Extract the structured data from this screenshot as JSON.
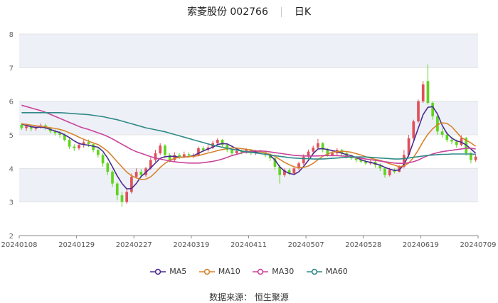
{
  "title": {
    "stock": "索菱股份 002766",
    "period": "日K"
  },
  "source": "数据来源： 恒生聚源",
  "colors": {
    "up": "#e0505a",
    "down": "#5fd51e",
    "MA5": "#4b2c91",
    "MA10": "#d7822c",
    "MA30": "#c9439a",
    "MA60": "#2f8a88",
    "band": "#eef0f7"
  },
  "chart_data": {
    "type": "candlestick",
    "xlabels": [
      "20240108",
      "20240129",
      "20240227",
      "20240319",
      "20240411",
      "20240507",
      "20240528",
      "20240619",
      "20240709"
    ],
    "ylim": [
      2,
      8
    ],
    "yticks": [
      2,
      3,
      4,
      5,
      6,
      7,
      8
    ],
    "candles": [
      [
        5.3,
        5.2,
        5.35,
        5.15
      ],
      [
        5.2,
        5.25,
        5.32,
        5.12
      ],
      [
        5.25,
        5.18,
        5.3,
        5.1
      ],
      [
        5.18,
        5.22,
        5.28,
        5.12
      ],
      [
        5.22,
        5.28,
        5.34,
        5.18
      ],
      [
        5.28,
        5.2,
        5.33,
        5.14
      ],
      [
        5.2,
        5.1,
        5.24,
        5.04
      ],
      [
        5.1,
        5.05,
        5.16,
        4.98
      ],
      [
        5.05,
        5.0,
        5.12,
        4.92
      ],
      [
        5.0,
        4.85,
        5.05,
        4.8
      ],
      [
        4.85,
        4.65,
        4.9,
        4.58
      ],
      [
        4.65,
        4.6,
        4.72,
        4.52
      ],
      [
        4.6,
        4.7,
        4.78,
        4.55
      ],
      [
        4.7,
        4.78,
        4.85,
        4.62
      ],
      [
        4.78,
        4.72,
        4.86,
        4.64
      ],
      [
        4.72,
        4.55,
        4.76,
        4.48
      ],
      [
        4.55,
        4.4,
        4.6,
        4.32
      ],
      [
        4.4,
        4.15,
        4.45,
        4.05
      ],
      [
        4.15,
        3.9,
        4.2,
        3.8
      ],
      [
        3.9,
        3.55,
        3.95,
        3.45
      ],
      [
        3.55,
        3.2,
        3.6,
        3.05
      ],
      [
        3.2,
        3.0,
        3.3,
        2.85
      ],
      [
        3.0,
        3.3,
        3.4,
        2.95
      ],
      [
        3.3,
        3.75,
        3.85,
        3.25
      ],
      [
        3.75,
        3.9,
        4.0,
        3.7
      ],
      [
        3.9,
        3.8,
        3.98,
        3.72
      ],
      [
        3.8,
        4.0,
        4.05,
        3.75
      ],
      [
        4.0,
        4.25,
        4.32,
        3.96
      ],
      [
        4.25,
        4.45,
        4.55,
        4.2
      ],
      [
        4.45,
        4.68,
        4.75,
        4.4
      ],
      [
        4.68,
        4.4,
        4.72,
        4.3
      ],
      [
        4.4,
        4.25,
        4.45,
        4.18
      ],
      [
        4.25,
        4.4,
        4.48,
        4.2
      ],
      [
        4.4,
        4.35,
        4.45,
        4.28
      ],
      [
        4.35,
        4.42,
        4.5,
        4.3
      ],
      [
        4.42,
        4.38,
        4.48,
        4.32
      ],
      [
        4.38,
        4.4,
        4.45,
        4.3
      ],
      [
        4.4,
        4.6,
        4.65,
        4.36
      ],
      [
        4.6,
        4.55,
        4.66,
        4.48
      ],
      [
        4.55,
        4.62,
        4.7,
        4.5
      ],
      [
        4.62,
        4.75,
        4.82,
        4.58
      ],
      [
        4.75,
        4.85,
        4.9,
        4.7
      ],
      [
        4.85,
        4.7,
        4.88,
        4.62
      ],
      [
        4.7,
        4.55,
        4.74,
        4.48
      ],
      [
        4.55,
        4.45,
        4.6,
        4.38
      ],
      [
        4.45,
        4.52,
        4.58,
        4.4
      ],
      [
        4.52,
        4.48,
        4.56,
        4.42
      ],
      [
        4.48,
        4.55,
        4.6,
        4.44
      ],
      [
        4.55,
        4.45,
        4.58,
        4.4
      ],
      [
        4.45,
        4.5,
        4.55,
        4.4
      ],
      [
        4.5,
        4.48,
        4.55,
        4.42
      ],
      [
        4.48,
        4.4,
        4.52,
        4.34
      ],
      [
        4.4,
        4.3,
        4.45,
        4.22
      ],
      [
        4.3,
        4.05,
        4.34,
        3.95
      ],
      [
        4.05,
        3.8,
        4.1,
        3.55
      ],
      [
        3.8,
        3.95,
        4.0,
        3.75
      ],
      [
        3.95,
        3.85,
        4.0,
        3.8
      ],
      [
        3.85,
        4.0,
        4.05,
        3.82
      ],
      [
        4.0,
        4.15,
        4.2,
        3.95
      ],
      [
        4.15,
        4.35,
        4.42,
        4.1
      ],
      [
        4.35,
        4.5,
        4.56,
        4.3
      ],
      [
        4.5,
        4.62,
        4.68,
        4.45
      ],
      [
        4.62,
        4.75,
        4.88,
        4.58
      ],
      [
        4.75,
        4.55,
        4.78,
        4.48
      ],
      [
        4.55,
        4.4,
        4.6,
        4.35
      ],
      [
        4.4,
        4.45,
        4.52,
        4.38
      ],
      [
        4.45,
        4.55,
        4.6,
        4.4
      ],
      [
        4.55,
        4.45,
        4.58,
        4.38
      ],
      [
        4.45,
        4.35,
        4.5,
        4.3
      ],
      [
        4.35,
        4.3,
        4.4,
        4.25
      ],
      [
        4.3,
        4.25,
        4.35,
        4.18
      ],
      [
        4.25,
        4.2,
        4.3,
        4.15
      ],
      [
        4.2,
        4.15,
        4.25,
        4.1
      ],
      [
        4.15,
        4.2,
        4.25,
        4.1
      ],
      [
        4.2,
        4.1,
        4.24,
        4.02
      ],
      [
        4.1,
        4.0,
        4.15,
        3.92
      ],
      [
        4.0,
        3.8,
        4.05,
        3.72
      ],
      [
        3.8,
        3.95,
        4.02,
        3.76
      ],
      [
        3.95,
        3.9,
        4.0,
        3.85
      ],
      [
        3.9,
        4.05,
        4.1,
        3.88
      ],
      [
        4.05,
        4.4,
        4.55,
        4.0
      ],
      [
        4.4,
        4.9,
        5.0,
        4.35
      ],
      [
        4.9,
        5.4,
        5.45,
        4.85
      ],
      [
        5.4,
        6.0,
        6.05,
        5.35
      ],
      [
        6.0,
        6.5,
        6.6,
        5.95
      ],
      [
        6.6,
        5.95,
        7.1,
        5.9
      ],
      [
        5.95,
        5.55,
        6.0,
        5.45
      ],
      [
        5.55,
        5.1,
        5.6,
        5.0
      ],
      [
        5.1,
        5.0,
        5.2,
        4.92
      ],
      [
        5.0,
        4.85,
        5.08,
        4.78
      ],
      [
        4.85,
        4.8,
        4.95,
        4.72
      ],
      [
        4.8,
        4.7,
        4.86,
        4.62
      ],
      [
        4.7,
        4.9,
        4.98,
        4.66
      ],
      [
        4.9,
        4.45,
        4.94,
        4.38
      ],
      [
        4.45,
        4.25,
        4.5,
        4.15
      ],
      [
        4.25,
        4.35,
        4.42,
        4.2
      ]
    ],
    "series": [
      {
        "name": "MA5",
        "values": [
          5.32,
          5.28,
          5.24,
          5.22,
          5.23,
          5.21,
          5.16,
          5.11,
          5.07,
          5.0,
          4.92,
          4.82,
          4.74,
          4.71,
          4.69,
          4.66,
          4.63,
          4.51,
          4.31,
          4.05,
          3.78,
          3.55,
          3.39,
          3.4,
          3.55,
          3.76,
          3.88,
          4.02,
          4.16,
          4.3,
          4.35,
          4.36,
          4.36,
          4.33,
          4.34,
          4.35,
          4.38,
          4.45,
          4.52,
          4.58,
          4.63,
          4.71,
          4.74,
          4.73,
          4.66,
          4.58,
          4.52,
          4.48,
          4.48,
          4.49,
          4.49,
          4.46,
          4.39,
          4.25,
          4.05,
          3.92,
          3.85,
          3.82,
          3.9,
          4.06,
          4.24,
          4.44,
          4.58,
          4.59,
          4.56,
          4.53,
          4.5,
          4.45,
          4.41,
          4.38,
          4.32,
          4.26,
          4.21,
          4.18,
          4.14,
          4.1,
          4.03,
          3.98,
          3.94,
          3.95,
          4.12,
          4.4,
          4.8,
          5.2,
          5.6,
          5.82,
          5.84,
          5.62,
          5.28,
          5.04,
          4.9,
          4.82,
          4.78,
          4.7,
          4.58,
          4.45
        ]
      },
      {
        "name": "MA10",
        "values": [
          5.33,
          5.31,
          5.29,
          5.27,
          5.25,
          5.24,
          5.21,
          5.19,
          5.16,
          5.12,
          5.06,
          5.0,
          4.93,
          4.87,
          4.81,
          4.76,
          4.71,
          4.62,
          4.51,
          4.36,
          4.2,
          4.04,
          3.89,
          3.78,
          3.72,
          3.67,
          3.68,
          3.75,
          3.88,
          4.03,
          4.15,
          4.24,
          4.3,
          4.33,
          4.34,
          4.35,
          4.36,
          4.38,
          4.42,
          4.46,
          4.49,
          4.53,
          4.56,
          4.59,
          4.61,
          4.61,
          4.59,
          4.57,
          4.55,
          4.52,
          4.49,
          4.46,
          4.42,
          4.36,
          4.27,
          4.18,
          4.11,
          4.05,
          4.02,
          4.03,
          4.07,
          4.15,
          4.26,
          4.36,
          4.43,
          4.48,
          4.5,
          4.51,
          4.5,
          4.48,
          4.44,
          4.4,
          4.35,
          4.31,
          4.27,
          4.24,
          4.19,
          4.14,
          4.1,
          4.05,
          4.08,
          4.16,
          4.33,
          4.55,
          4.8,
          5.02,
          5.18,
          5.3,
          5.36,
          5.34,
          5.24,
          5.08,
          4.92,
          4.84,
          4.76,
          4.66
        ]
      },
      {
        "name": "MA30",
        "values": [
          5.88,
          5.84,
          5.8,
          5.76,
          5.72,
          5.67,
          5.61,
          5.55,
          5.49,
          5.43,
          5.37,
          5.31,
          5.25,
          5.2,
          5.16,
          5.11,
          5.06,
          5.01,
          4.95,
          4.88,
          4.8,
          4.72,
          4.64,
          4.56,
          4.5,
          4.45,
          4.4,
          4.35,
          4.31,
          4.28,
          4.25,
          4.22,
          4.2,
          4.18,
          4.17,
          4.16,
          4.16,
          4.16,
          4.17,
          4.19,
          4.21,
          4.24,
          4.28,
          4.33,
          4.38,
          4.42,
          4.46,
          4.49,
          4.51,
          4.52,
          4.52,
          4.51,
          4.49,
          4.47,
          4.45,
          4.43,
          4.41,
          4.39,
          4.38,
          4.37,
          4.37,
          4.37,
          4.37,
          4.38,
          4.38,
          4.38,
          4.38,
          4.37,
          4.36,
          4.34,
          4.32,
          4.3,
          4.28,
          4.26,
          4.24,
          4.22,
          4.2,
          4.18,
          4.16,
          4.15,
          4.15,
          4.17,
          4.2,
          4.25,
          4.32,
          4.38,
          4.43,
          4.47,
          4.5,
          4.52,
          4.54,
          4.56,
          4.58,
          4.6,
          4.6,
          4.58
        ]
      },
      {
        "name": "MA60",
        "values": [
          5.66,
          5.66,
          5.66,
          5.66,
          5.66,
          5.66,
          5.66,
          5.66,
          5.66,
          5.65,
          5.64,
          5.63,
          5.62,
          5.61,
          5.6,
          5.58,
          5.56,
          5.54,
          5.51,
          5.48,
          5.45,
          5.41,
          5.37,
          5.33,
          5.29,
          5.25,
          5.21,
          5.18,
          5.15,
          5.12,
          5.09,
          5.05,
          5.01,
          4.97,
          4.93,
          4.89,
          4.85,
          4.81,
          4.77,
          4.73,
          4.69,
          4.66,
          4.63,
          4.6,
          4.57,
          4.55,
          4.52,
          4.5,
          4.48,
          4.46,
          4.44,
          4.42,
          4.4,
          4.38,
          4.36,
          4.34,
          4.32,
          4.31,
          4.3,
          4.29,
          4.29,
          4.28,
          4.28,
          4.28,
          4.29,
          4.3,
          4.31,
          4.32,
          4.33,
          4.34,
          4.34,
          4.34,
          4.34,
          4.33,
          4.32,
          4.31,
          4.3,
          4.29,
          4.28,
          4.28,
          4.29,
          4.31,
          4.33,
          4.35,
          4.37,
          4.39,
          4.4,
          4.41,
          4.42,
          4.42,
          4.43,
          4.43,
          4.43,
          4.43,
          4.43,
          4.42
        ]
      }
    ]
  },
  "legend": [
    {
      "label": "MA5",
      "color": "#4b2c91"
    },
    {
      "label": "MA10",
      "color": "#d7822c"
    },
    {
      "label": "MA30",
      "color": "#c9439a"
    },
    {
      "label": "MA60",
      "color": "#2f8a88"
    }
  ]
}
